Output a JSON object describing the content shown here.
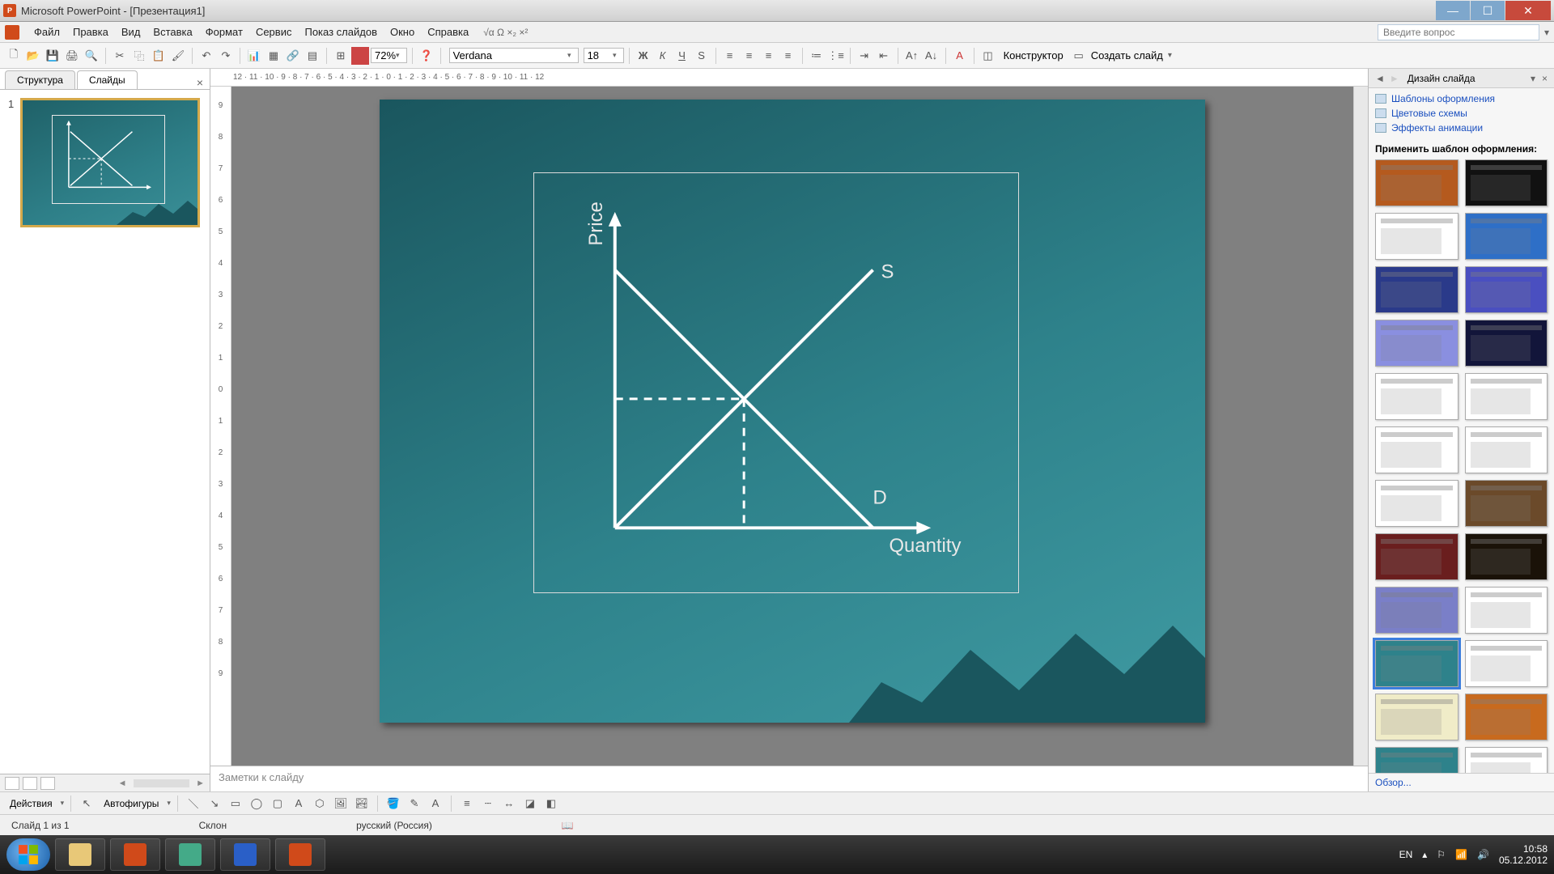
{
  "title": "Microsoft PowerPoint - [Презентация1]",
  "menus": [
    "Файл",
    "Правка",
    "Вид",
    "Вставка",
    "Формат",
    "Сервис",
    "Показ слайдов",
    "Окно",
    "Справка"
  ],
  "help_placeholder": "Введите вопрос",
  "zoom": "72%",
  "font": "Verdana",
  "font_size": "18",
  "toolbar_labels": {
    "designer": "Конструктор",
    "new_slide": "Создать слайд"
  },
  "tabs": {
    "structure": "Структура",
    "slides": "Слайды"
  },
  "thumb_number": "1",
  "h_ruler": "12 · 11 · 10 · 9 · 8 · 7 · 6 · 5 · 4 · 3 · 2 · 1 · 0 · 1 · 2 · 3 · 4 · 5 · 6 · 7 · 8 · 9 · 10 · 11 · 12",
  "v_ruler": [
    "9",
    "8",
    "7",
    "6",
    "5",
    "4",
    "3",
    "2",
    "1",
    "0",
    "1",
    "2",
    "3",
    "4",
    "5",
    "6",
    "7",
    "8",
    "9"
  ],
  "notes_placeholder": "Заметки к слайду",
  "status": {
    "slide": "Слайд 1 из 1",
    "theme": "Склон",
    "lang": "русский (Россия)"
  },
  "right_pane": {
    "title": "Дизайн слайда",
    "links": [
      "Шаблоны оформления",
      "Цветовые схемы",
      "Эффекты анимации"
    ],
    "section": "Применить шаблон оформления:",
    "browse": "Обзор..."
  },
  "draw": {
    "actions": "Действия",
    "autoshapes": "Автофигуры"
  },
  "tray": {
    "lang": "EN",
    "time": "10:58",
    "date": "05.12.2012"
  },
  "chart_data": {
    "type": "line",
    "title": "",
    "xlabel": "Quantity",
    "ylabel": "Price",
    "series": [
      {
        "name": "S",
        "x": [
          0,
          10
        ],
        "y": [
          0,
          10
        ]
      },
      {
        "name": "D",
        "x": [
          0,
          10
        ],
        "y": [
          10,
          0
        ]
      }
    ],
    "equilibrium": {
      "x": 5,
      "y": 5
    },
    "xlim": [
      0,
      12
    ],
    "ylim": [
      0,
      12
    ]
  },
  "templates": [
    {
      "bg": "#b55a1e"
    },
    {
      "bg": "#111"
    },
    {
      "bg": "#fff"
    },
    {
      "bg": "#2e6fc7"
    },
    {
      "bg": "#2a3a8a"
    },
    {
      "bg": "#4a4fc0"
    },
    {
      "bg": "#8a8fe0"
    },
    {
      "bg": "#12153a"
    },
    {
      "bg": "#fff"
    },
    {
      "bg": "#fff"
    },
    {
      "bg": "#fff"
    },
    {
      "bg": "#fff"
    },
    {
      "bg": "#fff"
    },
    {
      "bg": "#6b4a2a"
    },
    {
      "bg": "#6a1e1e"
    },
    {
      "bg": "#1a1208"
    },
    {
      "bg": "#7a7fc8"
    },
    {
      "bg": "#fff"
    },
    {
      "bg": "#2e828b",
      "sel": true
    },
    {
      "bg": "#fff"
    },
    {
      "bg": "#f0ecc8"
    },
    {
      "bg": "#c86a1e"
    },
    {
      "bg": "#2e828b"
    },
    {
      "bg": "#fff"
    }
  ]
}
